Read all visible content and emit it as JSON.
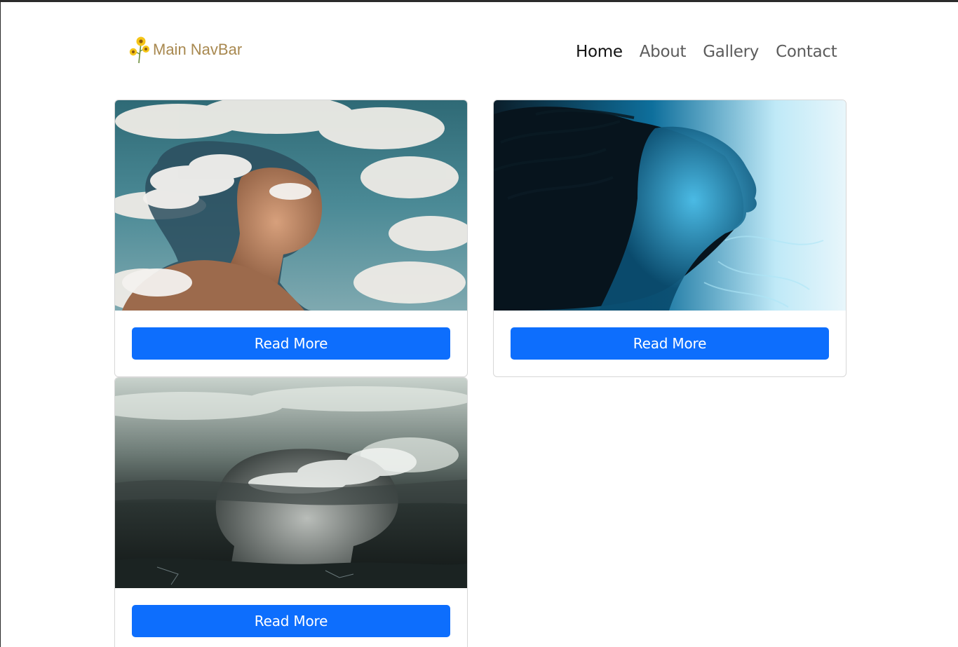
{
  "navbar": {
    "brand_label": "Main NavBar",
    "brand_icon": "sunflower-icon",
    "brand_color": "#a8884f",
    "links": [
      {
        "label": "Home",
        "active": true
      },
      {
        "label": "About",
        "active": false
      },
      {
        "label": "Gallery",
        "active": false
      },
      {
        "label": "Contact",
        "active": false
      }
    ]
  },
  "cards": [
    {
      "image": "woman-with-clouds-image",
      "button_label": "Read More"
    },
    {
      "image": "woman-blue-smoke-image",
      "button_label": "Read More"
    },
    {
      "image": "woman-stormy-sky-image",
      "button_label": "Read More"
    }
  ],
  "colors": {
    "button": "#0d6efd",
    "button_text": "#ffffff"
  }
}
